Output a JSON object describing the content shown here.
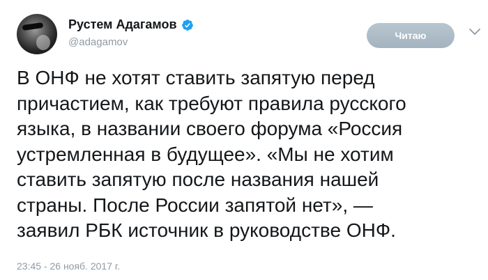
{
  "author": {
    "name": "Рустем Адагамов",
    "handle": "@adagamov"
  },
  "follow_button_label": "Читаю",
  "icons": {
    "verified": "verified-badge-icon",
    "menu": "chevron-down-icon"
  },
  "colors": {
    "verified": "#1da1f2",
    "follow_button": "#aab8c2",
    "secondary_text": "#8e9aa5"
  },
  "tweet": {
    "text": "В ОНФ не хотят ставить запятую перед\nпричастием, как требуют правила русского\nязыка, в названии своего форума «Россия\nустремленная в будущее». «Мы не хотим\nставить запятую после названия нашей\nстраны. После России запятой нет», —\nзаявил РБК источник в руководстве ОНФ.",
    "timestamp": "23:45 - 26 нояб. 2017 г."
  }
}
